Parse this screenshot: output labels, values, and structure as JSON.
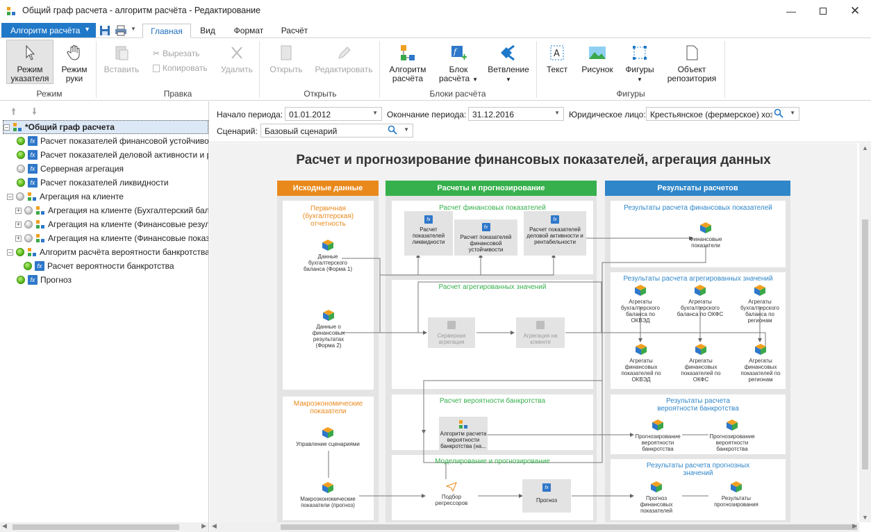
{
  "window": {
    "title": "Общий граф расчета - алгоритм расчёта - Редактирование"
  },
  "menu": {
    "app_button": "Алгоритм расчёта",
    "tabs": [
      "Главная",
      "Вид",
      "Формат",
      "Расчёт"
    ]
  },
  "ribbon": {
    "mode": {
      "pointer": [
        "Режим",
        "указателя"
      ],
      "hand": [
        "Режим",
        "руки"
      ],
      "group": "Режим"
    },
    "edit": {
      "paste": "Вставить",
      "cut": "Вырезать",
      "copy": "Копировать",
      "delete": "Удалить",
      "group": "Правка"
    },
    "open": {
      "open": "Открыть",
      "edit": "Редактировать",
      "group": "Открыть"
    },
    "blocks": {
      "algo": [
        "Алгоритм",
        "расчёта"
      ],
      "block": [
        "Блок",
        "расчёта"
      ],
      "branch": "Ветвление",
      "group": "Блоки расчёта"
    },
    "shapes": {
      "text": "Текст",
      "picture": "Рисунок",
      "figures": "Фигуры",
      "repo": [
        "Объект",
        "репозитория"
      ],
      "group": "Фигуры"
    }
  },
  "tree": {
    "root": "*Общий граф расчета",
    "items": [
      "Расчет показателей финансовой устойчивости",
      "Расчет показателей деловой активности и рен",
      "Серверная агрегация",
      "Расчет показателей ликвидности",
      "Агрегация на клиенте",
      "Агрегация на клиенте (Бухгалтерский баланс",
      "Агрегация на клиенте (Финансовые результ",
      "Агрегация на клиенте (Финансовые показате",
      "Алгоритм расчёта вероятности банкротства (н",
      "Расчет вероятности банкротства",
      "Прогноз"
    ]
  },
  "params": {
    "start_label": "Начало периода:",
    "start_value": "01.01.2012",
    "end_label": "Окончание периода:",
    "end_value": "31.12.2016",
    "entity_label": "Юридическое лицо:",
    "entity_value": "Крестьянское (фермерское) хозяй",
    "scenario_label": "Сценарий:",
    "scenario_value": "Базовый сценарий"
  },
  "diagram": {
    "title": "Расчет и прогнозирование финансовых показателей, агрегация данных",
    "col_headers": [
      "Исходные данные",
      "Расчеты и прогнозирование",
      "Результаты расчетов"
    ],
    "src_primary": "Первичная (бухгалтерская) отчетность",
    "src_balance": "Данные бухгалтерского баланса (Форма 1)",
    "src_results": "Данные о финансовых результатах (Форма 2)",
    "src_macro": "Макроэкономические показатели",
    "src_scen": "Управление сценариями",
    "src_macro_fc": "Макроэкономические показатели (прогноз)",
    "calc_fin": "Расчет финансовых показателей",
    "calc_liq": "Расчет показателей ликвидности",
    "calc_stab": "Расчет показателей финансовой устойчивости",
    "calc_act": "Расчет показателей деловой активности и рентабельности",
    "calc_agg": "Расчет агрегированных значений",
    "agg_server": "Серверная агрегация",
    "agg_client": "Агрегация на клиенте",
    "calc_bank": "Расчет вероятности банкротства",
    "bank_algo": "Алгоритм расчета вероятности банкротства (на...",
    "model": "Моделирование и прогнозирование",
    "regr": "Подбор регрессоров",
    "forecast": "Прогноз",
    "res_fin": "Результаты расчета финансовых показателей",
    "res_fin_node": "Финансовые показатели",
    "res_agg": "Результаты расчета агрегированных значений",
    "agg1": "Агрегаты бухгалтерского баланса по ОКВЭД",
    "agg2": "Агрегаты бухгалтерского баланса по ОКФС",
    "agg3": "Агрегаты бухгалтерского баланса по регионам",
    "agg4": "Агрегаты финансовых показателей по ОКВЭД",
    "agg5": "Агрегаты финансовых показателей по ОКФС",
    "agg6": "Агрегаты финансовых показателей по регионам",
    "res_bank": "Результаты расчета вероятности банкротства",
    "bank_fc1": "Прогнозирование вероятности банкротства",
    "bank_fc2": "Прогнозирование вероятности банкротства",
    "res_fc": "Результаты расчета прогнозных значений",
    "fc1": "Прогноз финансовых показателей",
    "fc2": "Результаты прогнозирования"
  },
  "colors": {
    "orange": "#e9891c",
    "green": "#36b04c",
    "blue": "#2f86c9",
    "accent": "#1f78c8"
  }
}
